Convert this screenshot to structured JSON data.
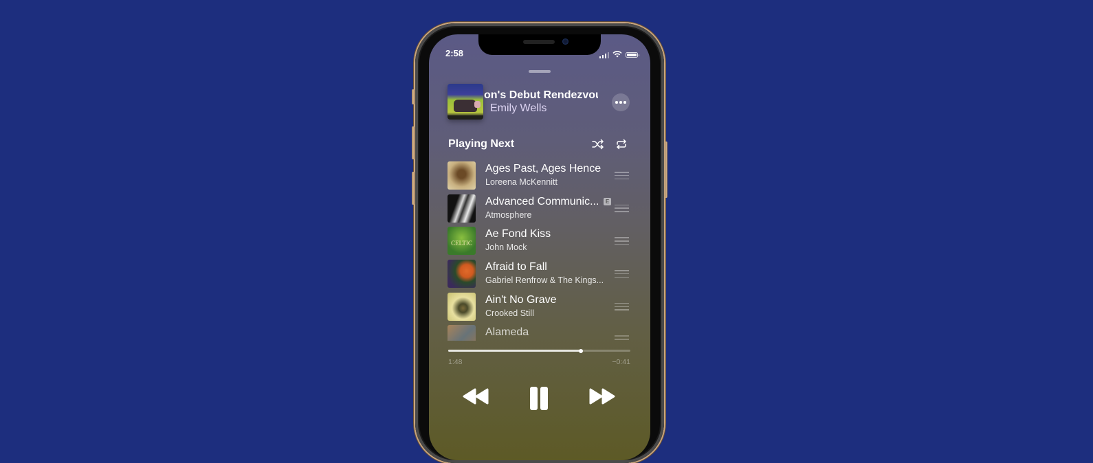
{
  "status_bar": {
    "time": "2:58",
    "icons": [
      "cellular-signal-icon",
      "wifi-icon",
      "battery-icon"
    ]
  },
  "now_playing": {
    "title": "on's Debut Rendezvou",
    "artist": "Emily Wells",
    "more_button": "more-options-icon"
  },
  "playing_next": {
    "header": "Playing Next",
    "shuffle_icon": "shuffle-icon",
    "repeat_icon": "repeat-icon",
    "tracks": [
      {
        "title": "Ages Past, Ages Hence",
        "artist": "Loreena McKennitt",
        "explicit": false,
        "art_colors": [
          "#d8c8a0",
          "#6b4a26"
        ]
      },
      {
        "title": "Advanced Communic...",
        "artist": "Atmosphere",
        "explicit": true,
        "explicit_label": "E",
        "art_colors": [
          "#1a1a1a",
          "#d0d0d0"
        ]
      },
      {
        "title": "Ae Fond Kiss",
        "artist": "John Mock",
        "explicit": false,
        "art_label": "CELTIC",
        "art_colors": [
          "#3a7a2a",
          "#8ac040"
        ]
      },
      {
        "title": "Afraid to Fall",
        "artist": "Gabriel Renfrow & The Kings...",
        "explicit": false,
        "art_colors": [
          "#3a2a5a",
          "#e06a2a"
        ]
      },
      {
        "title": "Ain't No Grave",
        "artist": "Crooked Still",
        "explicit": false,
        "art_colors": [
          "#e8e0a0",
          "#7a6a3a"
        ]
      },
      {
        "title": "Alameda",
        "artist": "",
        "explicit": false,
        "art_colors": [
          "#c09060",
          "#6a7a8a"
        ]
      }
    ]
  },
  "playback": {
    "elapsed": "1:48",
    "remaining": "−0:41",
    "progress": 0.73,
    "controls": [
      "rewind-icon",
      "pause-icon",
      "fast-forward-icon"
    ]
  },
  "colors": {
    "background": "#1d2e7e",
    "screen_top": "#5b5a86",
    "screen_bottom": "#5d5a26",
    "phone_frame": "#c9a57f"
  }
}
